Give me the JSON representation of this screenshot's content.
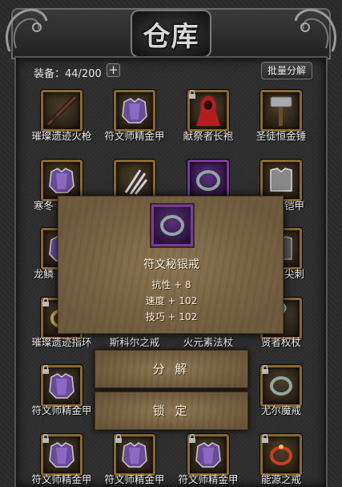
{
  "title": "仓库",
  "inventory": {
    "label": "装备：44/200",
    "add_label": "+",
    "batch_button": "批量分解"
  },
  "rows": [
    {
      "items": [
        {
          "name": "璀璨遗迹火枪",
          "icon": "musket-icon",
          "rarity": "gold",
          "locked": false
        },
        {
          "name": "符文师精金甲",
          "icon": "armor-icon",
          "rarity": "gold",
          "locked": false
        },
        {
          "name": "献祭者长袍",
          "icon": "robe-icon",
          "rarity": "gold",
          "locked": true
        },
        {
          "name": "圣徒恒金锤",
          "icon": "hammer-icon",
          "rarity": "gold",
          "locked": false
        }
      ]
    },
    {
      "items": [
        {
          "name": "寒冬",
          "icon": "armor-icon",
          "rarity": "gold",
          "locked": false
        },
        {
          "name": "",
          "icon": "claw-icon",
          "rarity": "gold",
          "locked": false
        },
        {
          "name": "",
          "icon": "ring-icon",
          "rarity": "purple",
          "locked": false
        },
        {
          "name": "铠甲",
          "icon": "chest-armor-icon",
          "rarity": "gold",
          "locked": false
        }
      ]
    },
    {
      "items": [
        {
          "name": "龙鳞",
          "icon": "armor-icon",
          "rarity": "gold",
          "locked": false
        },
        {
          "name": "尖刺",
          "icon": "chest-armor-icon",
          "rarity": "gold",
          "locked": false
        }
      ]
    },
    {
      "items": [
        {
          "name": "璀璨遗迹指环",
          "icon": "ring-icon",
          "rarity": "gold",
          "locked": true
        },
        {
          "name": "斯科尔之戒",
          "icon": "ring-icon",
          "rarity": "gold",
          "locked": false
        },
        {
          "name": "火元素法杖",
          "icon": "staff-icon",
          "rarity": "gold",
          "locked": false
        },
        {
          "name": "贤者权杖",
          "icon": "scepter-icon",
          "rarity": "gold",
          "locked": false
        }
      ]
    },
    {
      "items": [
        {
          "name": "符文师精金甲",
          "icon": "armor-icon",
          "rarity": "gold",
          "locked": true
        },
        {
          "name": "尤尔魔戒",
          "icon": "ring-icon",
          "rarity": "gold",
          "locked": true
        }
      ]
    },
    {
      "items": [
        {
          "name": "符文师精金甲",
          "icon": "armor-icon",
          "rarity": "gold",
          "locked": true
        },
        {
          "name": "符文师精金甲",
          "icon": "armor-icon",
          "rarity": "gold",
          "locked": true
        },
        {
          "name": "符文师精金甲",
          "icon": "armor-icon",
          "rarity": "gold",
          "locked": true
        },
        {
          "name": "能源之戒",
          "icon": "red-ring-icon",
          "rarity": "gold",
          "locked": true
        }
      ]
    }
  ],
  "popup": {
    "item_name": "符文秘银戒",
    "icon": "ring-icon",
    "rarity": "purple",
    "stats": [
      "抗性 + 8",
      "速度 + 102",
      "技巧 + 102"
    ]
  },
  "actions": {
    "decompose": "分 解",
    "lock": "锁 定"
  },
  "colors": {
    "gold_border": "#8a6a2a",
    "purple_border": "#7b3aa0",
    "parchment": "#7d6848"
  }
}
